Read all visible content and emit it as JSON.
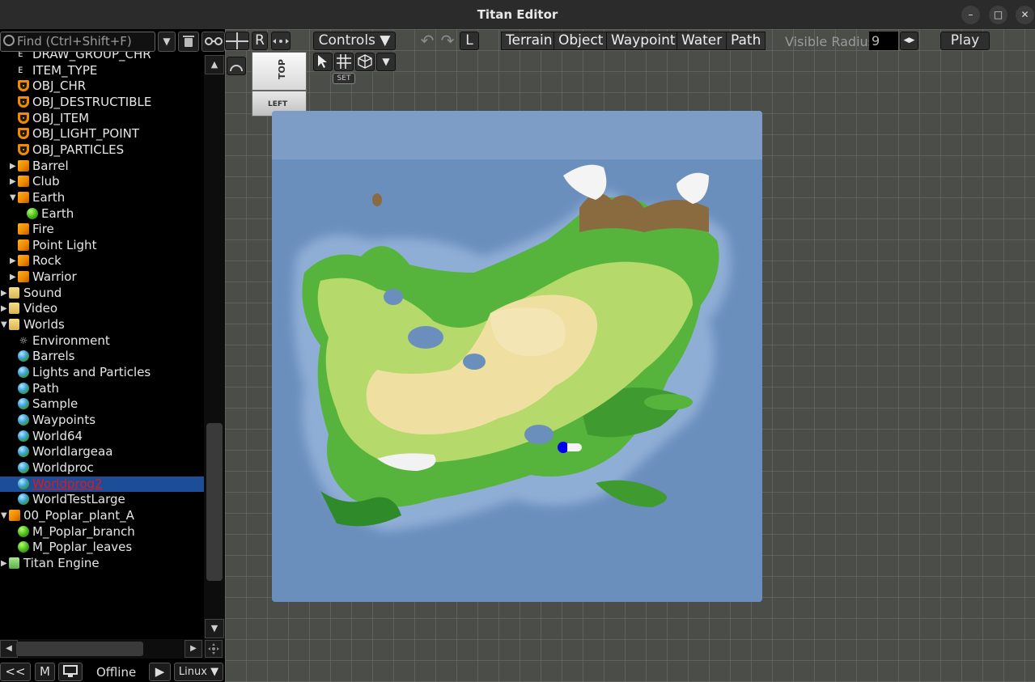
{
  "window": {
    "title": "Titan Editor",
    "min_label": "–",
    "max_label": "□",
    "close_label": "✕"
  },
  "left_panel": {
    "search_placeholder": "Find (Ctrl+Shift+F)",
    "dropdown_glyph": "▼",
    "r_label": "R"
  },
  "tree": [
    {
      "label": "DRAW_GROUP_CHR",
      "icon": "doc",
      "indent": 1,
      "arrow": ""
    },
    {
      "label": "ITEM_TYPE",
      "icon": "doc",
      "indent": 1,
      "arrow": ""
    },
    {
      "label": "OBJ_CHR",
      "icon": "shield",
      "indent": 1,
      "arrow": ""
    },
    {
      "label": "OBJ_DESTRUCTIBLE",
      "icon": "shield",
      "indent": 1,
      "arrow": ""
    },
    {
      "label": "OBJ_ITEM",
      "icon": "shield",
      "indent": 1,
      "arrow": ""
    },
    {
      "label": "OBJ_LIGHT_POINT",
      "icon": "shield",
      "indent": 1,
      "arrow": ""
    },
    {
      "label": "OBJ_PARTICLES",
      "icon": "shield",
      "indent": 1,
      "arrow": ""
    },
    {
      "label": "Barrel",
      "icon": "cube",
      "indent": 1,
      "arrow": "▶"
    },
    {
      "label": "Club",
      "icon": "cube",
      "indent": 1,
      "arrow": "▶"
    },
    {
      "label": "Earth",
      "icon": "cube",
      "indent": 1,
      "arrow": "▼"
    },
    {
      "label": "Earth",
      "icon": "ball",
      "indent": 2,
      "arrow": ""
    },
    {
      "label": "Fire",
      "icon": "cube",
      "indent": 1,
      "arrow": ""
    },
    {
      "label": "Point Light",
      "icon": "cube",
      "indent": 1,
      "arrow": ""
    },
    {
      "label": "Rock",
      "icon": "cube",
      "indent": 1,
      "arrow": "▶"
    },
    {
      "label": "Warrior",
      "icon": "cube",
      "indent": 1,
      "arrow": "▶"
    },
    {
      "label": "Sound",
      "icon": "folder",
      "indent": 0,
      "arrow": "▶"
    },
    {
      "label": "Video",
      "icon": "folder",
      "indent": 0,
      "arrow": "▶"
    },
    {
      "label": "Worlds",
      "icon": "folder",
      "indent": 0,
      "arrow": "▼"
    },
    {
      "label": "Environment",
      "icon": "sun",
      "indent": 1,
      "arrow": ""
    },
    {
      "label": "Barrels",
      "icon": "globe",
      "indent": 1,
      "arrow": ""
    },
    {
      "label": "Lights and Particles",
      "icon": "globe",
      "indent": 1,
      "arrow": ""
    },
    {
      "label": "Path",
      "icon": "globe",
      "indent": 1,
      "arrow": ""
    },
    {
      "label": "Sample",
      "icon": "globe",
      "indent": 1,
      "arrow": ""
    },
    {
      "label": "Waypoints",
      "icon": "globe",
      "indent": 1,
      "arrow": ""
    },
    {
      "label": "World64",
      "icon": "globe",
      "indent": 1,
      "arrow": ""
    },
    {
      "label": "Worldlargeaa",
      "icon": "globe",
      "indent": 1,
      "arrow": ""
    },
    {
      "label": "Worldproc",
      "icon": "globe",
      "indent": 1,
      "arrow": ""
    },
    {
      "label": "Worldprog2",
      "icon": "globe",
      "indent": 1,
      "arrow": "",
      "selected": true
    },
    {
      "label": "WorldTestLarge",
      "icon": "globe",
      "indent": 1,
      "arrow": ""
    },
    {
      "label": "00_Poplar_plant_A",
      "icon": "cube",
      "indent": 0,
      "arrow": "▼"
    },
    {
      "label": "M_Poplar_branch",
      "icon": "ball",
      "indent": 1,
      "arrow": ""
    },
    {
      "label": "M_Poplar_leaves",
      "icon": "ball",
      "indent": 1,
      "arrow": ""
    },
    {
      "label": "Titan Engine",
      "icon": "folder-green",
      "indent": 0,
      "arrow": "▶"
    }
  ],
  "bottom_bar": {
    "back_label": "<<",
    "m_label": "M",
    "status": "Offline",
    "play_glyph": "▶",
    "platform": "Linux ▼"
  },
  "toolbar": {
    "controls_label": "Controls ▼",
    "l_label": "L",
    "undo_glyph": "↶",
    "redo_glyph": "↷",
    "modes": [
      "Terrain",
      "Object",
      "Waypoint",
      "Water",
      "Path"
    ],
    "visible_radius_label": "Visible Radius",
    "visible_radius_value": "9",
    "play_label": "Play",
    "set_label": "SET",
    "stepper_glyph": "◀▶"
  },
  "view_cube": {
    "top_label": "TOP",
    "left_label": "LEFT"
  }
}
